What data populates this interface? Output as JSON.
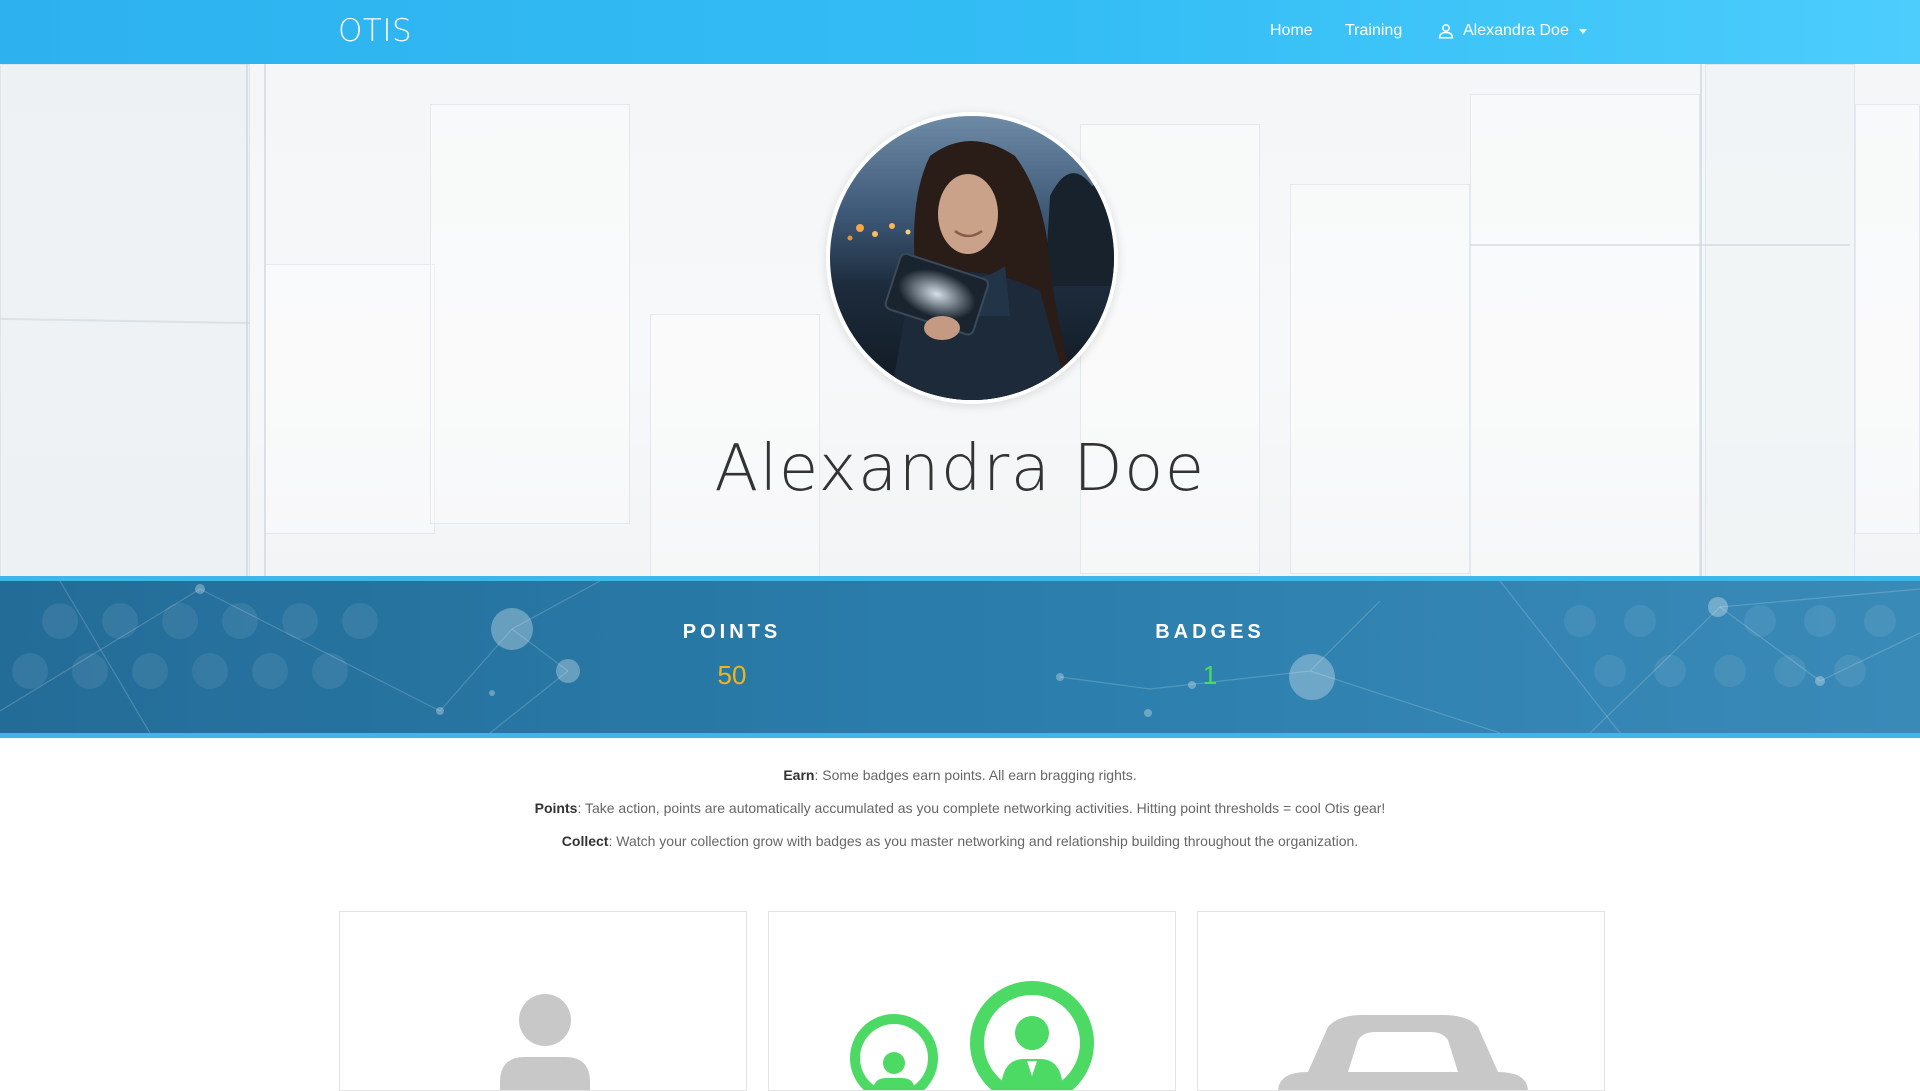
{
  "nav": {
    "brand": "OTIS",
    "home": "Home",
    "training": "Training",
    "user_name": "Alexandra Doe"
  },
  "profile": {
    "name": "Alexandra Doe"
  },
  "stats": {
    "points_label": "POINTS",
    "points_value": "50",
    "badges_label": "BADGES",
    "badges_value": "1"
  },
  "info": {
    "earn_label": "Earn",
    "earn_text": ": Some badges earn points. All earn bragging rights.",
    "points_label": "Points",
    "points_text": ": Take action, points are automatically accumulated as you complete networking activities. Hitting point thresholds = cool Otis gear!",
    "collect_label": "Collect",
    "collect_text": ": Watch your collection grow with badges as you master networking and relationship building throughout the organization."
  },
  "colors": {
    "navbar": "#33bdf5",
    "stats_band": "#2a7dab",
    "points_value": "#f1b51c",
    "badges_value": "#4cd964",
    "badge_earned": "#4cd964",
    "badge_locked": "#c8c8c8"
  },
  "icons": {
    "user": "user-icon",
    "caret": "caret-down-icon",
    "badge_1": "person-badge-icon",
    "badge_2": "network-badge-icon",
    "badge_3": "car-badge-icon"
  }
}
